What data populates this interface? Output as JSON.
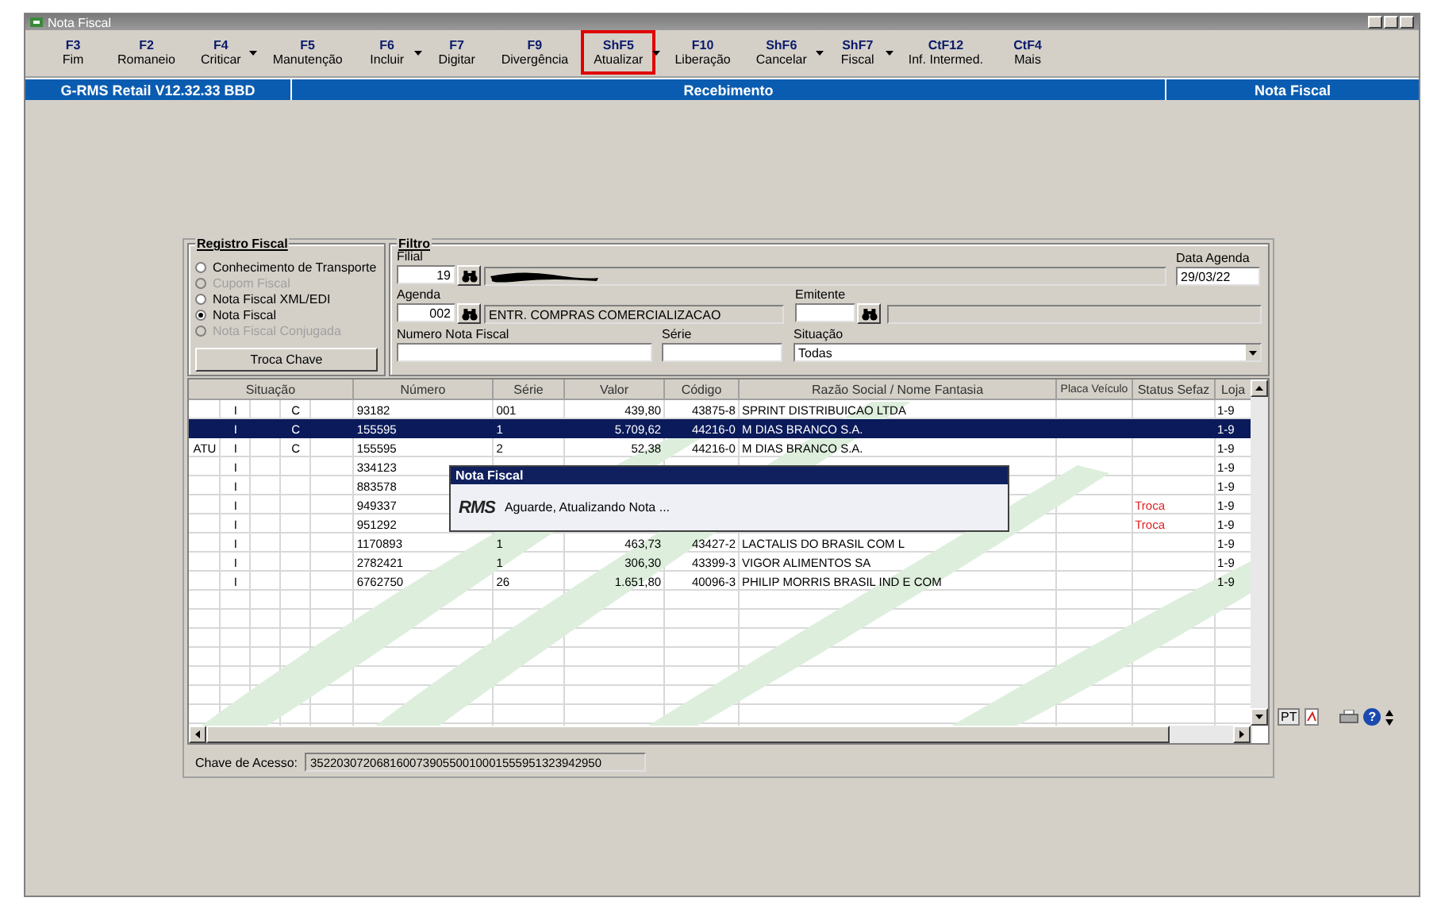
{
  "window": {
    "title": "Nota Fiscal"
  },
  "toolbar": [
    {
      "key": "F3",
      "label": "Fim",
      "dropdown": false,
      "highlighted": false
    },
    {
      "key": "F2",
      "label": "Romaneio",
      "dropdown": false,
      "highlighted": false
    },
    {
      "key": "F4",
      "label": "Criticar",
      "dropdown": true,
      "highlighted": false
    },
    {
      "key": "F5",
      "label": "Manutenção",
      "dropdown": false,
      "highlighted": false
    },
    {
      "key": "F6",
      "label": "Incluir",
      "dropdown": true,
      "highlighted": false
    },
    {
      "key": "F7",
      "label": "Digitar",
      "dropdown": false,
      "highlighted": false
    },
    {
      "key": "F9",
      "label": "Divergência",
      "dropdown": false,
      "highlighted": false
    },
    {
      "key": "ShF5",
      "label": "Atualizar",
      "dropdown": true,
      "highlighted": true
    },
    {
      "key": "F10",
      "label": "Liberação",
      "dropdown": false,
      "highlighted": false
    },
    {
      "key": "ShF6",
      "label": "Cancelar",
      "dropdown": true,
      "highlighted": false
    },
    {
      "key": "ShF7",
      "label": "Fiscal",
      "dropdown": true,
      "highlighted": false
    },
    {
      "key": "CtF12",
      "label": "Inf. Intermed.",
      "dropdown": false,
      "highlighted": false
    },
    {
      "key": "CtF4",
      "label": "Mais",
      "dropdown": false,
      "highlighted": false
    }
  ],
  "header_bar": {
    "version": "G-RMS Retail V12.32.33 BBD",
    "module": "Recebimento",
    "screen": "Nota Fiscal"
  },
  "registro_fiscal": {
    "title": "Registro Fiscal",
    "options": [
      {
        "label": "Conhecimento de Transporte",
        "selected": false,
        "disabled": false
      },
      {
        "label": "Cupom Fiscal",
        "selected": false,
        "disabled": true
      },
      {
        "label": "Nota Fiscal XML/EDI",
        "selected": false,
        "disabled": false
      },
      {
        "label": "Nota Fiscal",
        "selected": true,
        "disabled": false
      },
      {
        "label": "Nota Fiscal Conjugada",
        "selected": false,
        "disabled": true
      }
    ],
    "button": "Troca Chave"
  },
  "filtro": {
    "title": "Filtro",
    "filial_label": "Filial",
    "filial": "19",
    "data_agenda_label": "Data Agenda",
    "data_agenda": "29/03/22",
    "agenda_label": "Agenda",
    "agenda": "002",
    "agenda_desc": "ENTR. COMPRAS COMERCIALIZACAO",
    "emitente_label": "Emitente",
    "numero_label": "Numero Nota Fiscal",
    "serie_label": "Série",
    "situacao_label": "Situação",
    "situacao": "Todas"
  },
  "table": {
    "columns": [
      "Situação",
      "Número",
      "Série",
      "Valor",
      "Código",
      "Razão Social / Nome Fantasia",
      "Placa Veículo",
      "Status Sefaz",
      "Loja"
    ],
    "rows": [
      {
        "type": "I",
        "mark": "C",
        "numero": "93182",
        "serie": "001",
        "valor": "439,80",
        "codigo": "43875-8",
        "razao": "SPRINT DISTRIBUICAO LTDA",
        "loja": "1-9",
        "selected": false
      },
      {
        "type": "I",
        "mark": "C",
        "numero": "155595",
        "serie": "1",
        "valor": "5.709,62",
        "codigo": "44216-0",
        "razao": "M DIAS BRANCO S.A.",
        "loja": "1-9",
        "selected": true
      },
      {
        "flag": "ATU",
        "type": "I",
        "mark": "C",
        "numero": "155595",
        "serie": "2",
        "valor": "52,38",
        "codigo": "44216-0",
        "razao": "M DIAS BRANCO S.A.",
        "loja": "1-9",
        "selected": false
      },
      {
        "type": "I",
        "numero": "334123",
        "loja": "1-9",
        "selected": false
      },
      {
        "type": "I",
        "numero": "883578",
        "loja": "1-9",
        "selected": false
      },
      {
        "type": "I",
        "numero": "949337",
        "status": "Troca",
        "loja": "1-9",
        "selected": false
      },
      {
        "type": "I",
        "numero": "951292",
        "status": "Troca",
        "loja": "1-9",
        "selected": false
      },
      {
        "type": "I",
        "numero": "1170893",
        "serie": "1",
        "valor": "463,73",
        "codigo": "43427-2",
        "razao": "LACTALIS DO BRASIL COM L",
        "loja": "1-9",
        "selected": false
      },
      {
        "type": "I",
        "numero": "2782421",
        "serie": "1",
        "valor": "306,30",
        "codigo": "43399-3",
        "razao": "VIGOR ALIMENTOS SA",
        "loja": "1-9",
        "selected": false
      },
      {
        "type": "I",
        "numero": "6762750",
        "serie": "26",
        "valor": "1.651,80",
        "codigo": "40096-3",
        "razao": "PHILIP MORRIS BRASIL IND E COM",
        "loja": "1-9",
        "selected": false
      }
    ]
  },
  "chave": {
    "label": "Chave de Acesso:",
    "value": "35220307206816007390550010001555951323942950"
  },
  "side_tools": {
    "language": "PT",
    "help": "?"
  },
  "dialog": {
    "title": "Nota Fiscal",
    "logo": "RMS",
    "message": "Aguarde, Atualizando Nota ..."
  }
}
